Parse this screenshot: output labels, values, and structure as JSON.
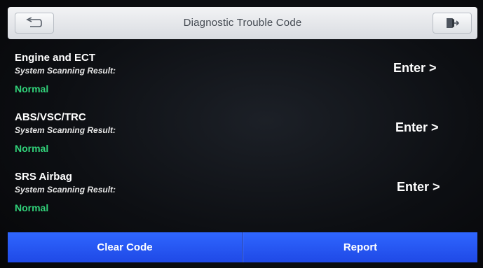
{
  "header": {
    "title": "Diagnostic Trouble Code",
    "back_icon": "back-arrow-icon",
    "exit_icon": "exit-door-icon"
  },
  "systems": [
    {
      "name": "Engine and ECT",
      "subtitle": "System Scanning Result:",
      "status": "Normal",
      "action": "Enter >"
    },
    {
      "name": "ABS/VSC/TRC",
      "subtitle": "System Scanning Result:",
      "status": "Normal",
      "action": "Enter >"
    },
    {
      "name": "SRS Airbag",
      "subtitle": "System Scanning Result:",
      "status": "Normal",
      "action": "Enter >"
    }
  ],
  "footer": {
    "clear_label": "Clear Code",
    "report_label": "Report"
  },
  "colors": {
    "status_ok": "#31d27a",
    "footer_blue": "#2f66ff",
    "header_bg": "#e6e8eb"
  }
}
